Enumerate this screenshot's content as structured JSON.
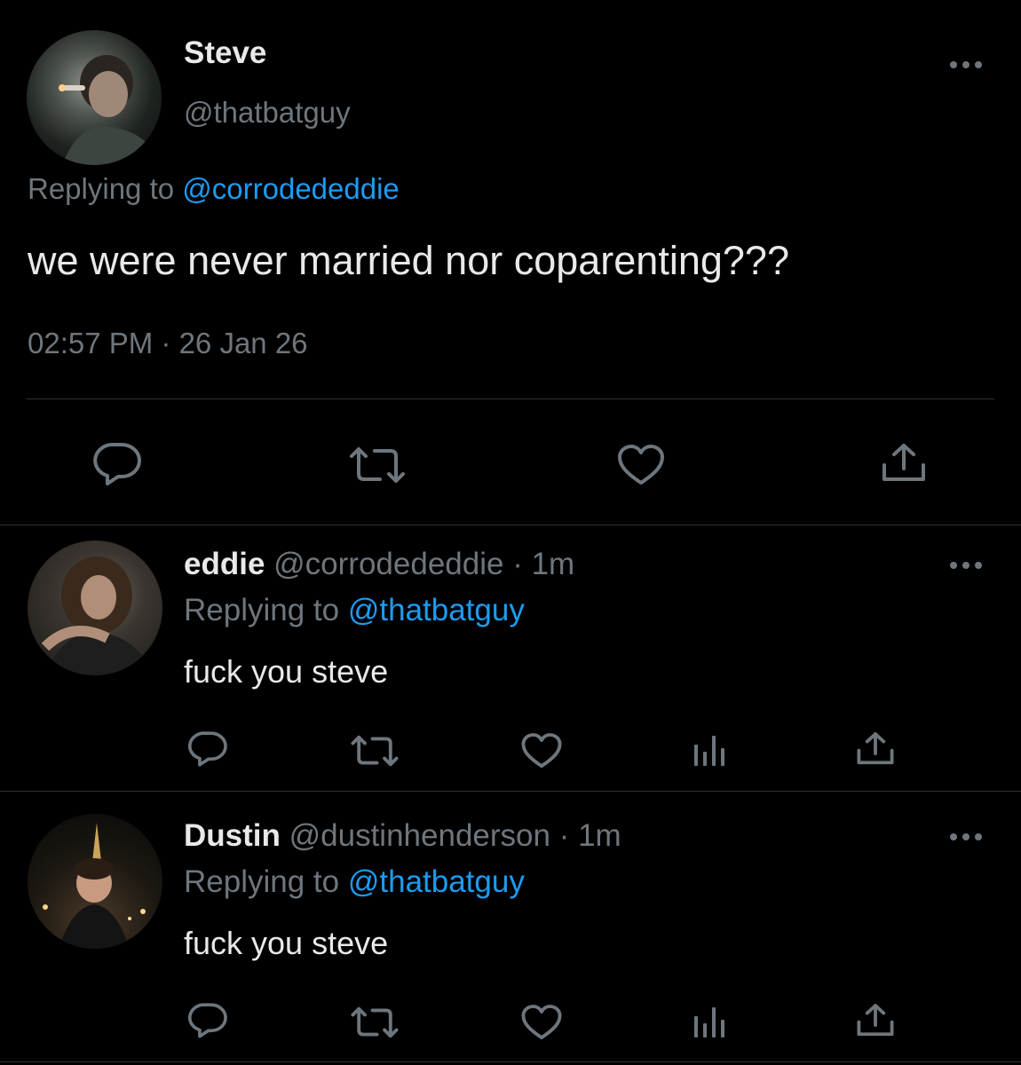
{
  "main_tweet": {
    "name": "Steve",
    "handle": "@thatbatguy",
    "replying_prefix": "Replying to",
    "replying_to": "@corrodededdie",
    "text": "we were never married nor coparenting???",
    "timestamp": "02:57 PM · 26 Jan 26"
  },
  "replies": [
    {
      "name": "eddie",
      "handle": "@corrodededdie",
      "age": "· 1m",
      "replying_prefix": "Replying to",
      "replying_to": "@thatbatguy",
      "text": "fuck you steve"
    },
    {
      "name": "Dustin",
      "handle": "@dustinhenderson",
      "age": "· 1m",
      "replying_prefix": "Replying to",
      "replying_to": "@thatbatguy",
      "text": "fuck you steve"
    }
  ],
  "icons": {
    "reply": "reply-icon",
    "retweet": "retweet-icon",
    "like": "heart-icon",
    "analytics": "analytics-icon",
    "share": "share-icon",
    "more": "more-icon"
  },
  "colors": {
    "background": "#000000",
    "text": "#e7e9ea",
    "muted": "#6e767d",
    "link": "#1d9bf0",
    "divider": "#2f3336"
  }
}
